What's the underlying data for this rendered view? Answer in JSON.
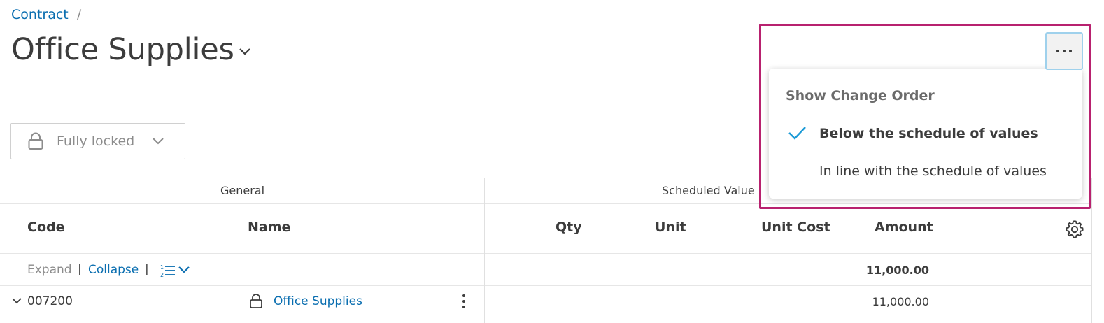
{
  "breadcrumb": {
    "link": "Contract",
    "separator": "/"
  },
  "page": {
    "title": "Office Supplies"
  },
  "lock_dropdown": {
    "label": "Fully locked"
  },
  "table": {
    "groups": {
      "general": "General",
      "scheduled_values": "Scheduled Value"
    },
    "columns": {
      "code": "Code",
      "name": "Name",
      "qty": "Qty",
      "unit": "Unit",
      "unit_cost": "Unit Cost",
      "amount": "Amount"
    },
    "toolbar": {
      "expand": "Expand",
      "collapse": "Collapse",
      "separator": "|"
    },
    "total_amount": "11,000.00",
    "rows": [
      {
        "code": "007200",
        "name": "Office Supplies",
        "amount": "11,000.00"
      }
    ]
  },
  "menu": {
    "heading": "Show Change Order",
    "options": [
      {
        "label": "Below the schedule of values",
        "selected": true
      },
      {
        "label": "In line with the schedule of values",
        "selected": false
      }
    ]
  },
  "icons": {
    "more": "more-horizontal-icon",
    "title_chevron": "chevron-down-icon",
    "lock": "lock-icon",
    "settings": "gear-icon",
    "check": "check-icon",
    "list_view": "numbered-list-icon",
    "row_actions": "more-vertical-icon"
  },
  "colors": {
    "link": "#0a6eb0",
    "highlight": "#b8216f",
    "check": "#1b9ad6",
    "focus_ring": "#9fd1ec"
  }
}
